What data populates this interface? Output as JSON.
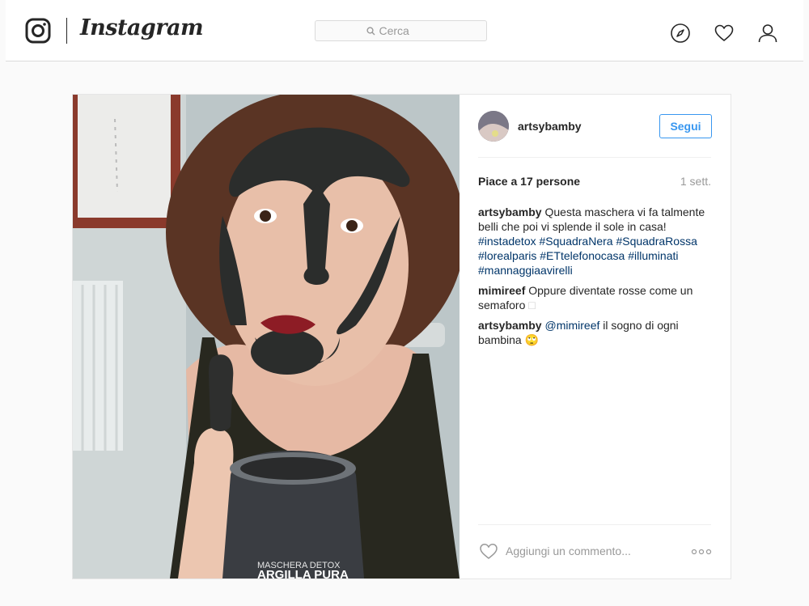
{
  "header": {
    "wordmark": "Instagram",
    "search": {
      "placeholder": "Cerca"
    },
    "icons": [
      "instagram-logo-icon",
      "compass-icon",
      "heart-icon",
      "person-icon"
    ]
  },
  "post": {
    "photo": {
      "jar_label_line1": "MASCHERA DETOX",
      "jar_label_line2": "ARGILLA PURA"
    },
    "author": {
      "username": "artsybamby"
    },
    "follow_label": "Segui",
    "likes_text": "Piace a 17 persone",
    "time_ago": "1 sett.",
    "comments": [
      {
        "user": "artsybamby",
        "text": "Questa maschera vi fa talmente belli che poi vi splende il sole in casa!",
        "hashtags": [
          "#instadetox",
          "#SquadraNera",
          "#SquadraRossa",
          "#lorealparis",
          "#ETtelefonocasa",
          "#illuminati",
          "#mannaggiaavirelli"
        ]
      },
      {
        "user": "mimireef",
        "text": "Oppure diventate rosse come un semaforo",
        "emoji": "□"
      },
      {
        "user": "artsybamby",
        "mention": "@mimireef",
        "text": "il sogno di ogni bambina",
        "emoji": "🙄"
      }
    ],
    "add_comment_placeholder": "Aggiungi un commento...",
    "colors": {
      "link": "#003569",
      "accent": "#3897f0",
      "muted": "#999999"
    }
  }
}
